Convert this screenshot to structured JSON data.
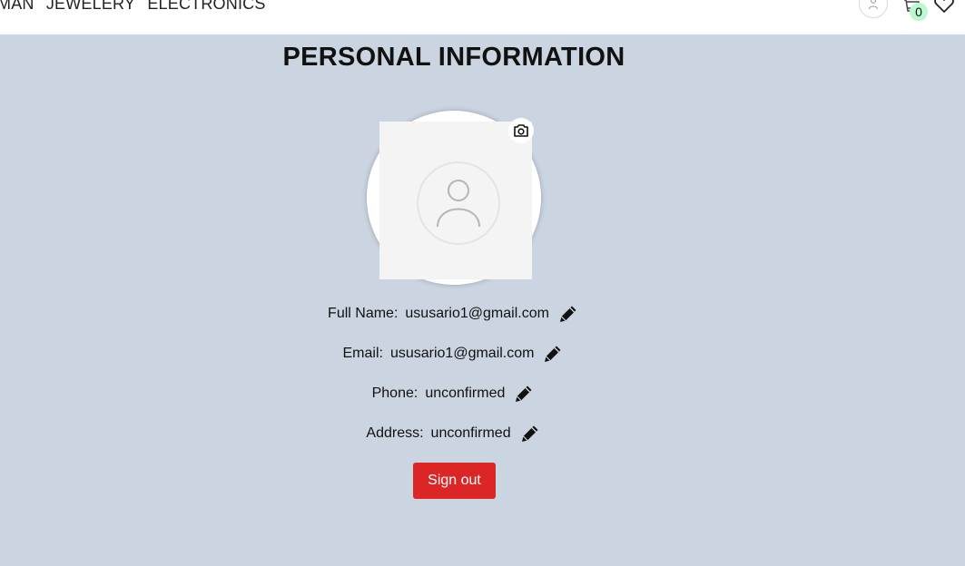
{
  "nav": {
    "links": [
      "MAN",
      "JEWELERY",
      "ELECTRONICS"
    ],
    "cart_count": "0",
    "icons": {
      "user": "user-icon",
      "cart": "cart-icon",
      "wishlist": "heart-icon"
    }
  },
  "page": {
    "title": "PERSONAL INFORMATION"
  },
  "profile": {
    "avatar_icon": "user-placeholder-icon",
    "camera_icon": "camera-icon",
    "fields": [
      {
        "label": "Full Name:",
        "value": "ususario1@gmail.com"
      },
      {
        "label": "Email:",
        "value": "ususario1@gmail.com"
      },
      {
        "label": "Phone:",
        "value": "unconfirmed"
      },
      {
        "label": "Address:",
        "value": "unconfirmed"
      }
    ],
    "edit_icon": "pencil-icon",
    "signout_label": "Sign out"
  },
  "colors": {
    "background": "#cbd5e1",
    "header": "#ffffff",
    "signout": "#dc2626",
    "badge": "#bbf7d0"
  }
}
